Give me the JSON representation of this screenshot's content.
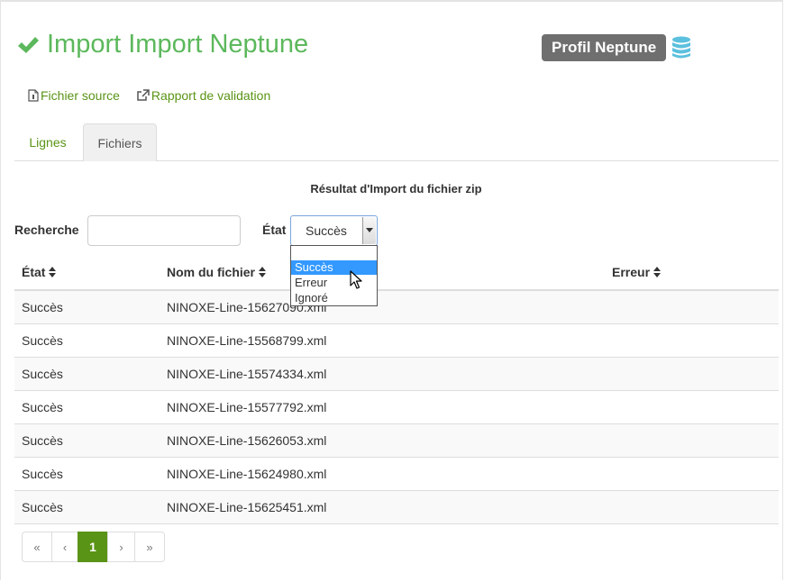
{
  "header": {
    "title": "Import Import Neptune",
    "profile_badge": "Profil Neptune"
  },
  "links": {
    "source_file": "Fichier source",
    "validation_report": "Rapport de validation"
  },
  "tabs": [
    {
      "label": "Lignes",
      "active": false
    },
    {
      "label": "Fichiers",
      "active": true
    }
  ],
  "section_title": "Résultat d'Import du fichier zip",
  "filters": {
    "search_label": "Recherche",
    "search_value": "",
    "state_label": "État",
    "state_selected": "Succès",
    "state_options": [
      "",
      "Succès",
      "Erreur",
      "Ignoré"
    ],
    "state_highlighted": "Succès"
  },
  "table": {
    "columns": [
      "État",
      "Nom du fichier",
      "Erreur"
    ],
    "rows": [
      {
        "etat": "Succès",
        "nom": "NINOXE-Line-15627090.xml",
        "erreur": ""
      },
      {
        "etat": "Succès",
        "nom": "NINOXE-Line-15568799.xml",
        "erreur": ""
      },
      {
        "etat": "Succès",
        "nom": "NINOXE-Line-15574334.xml",
        "erreur": ""
      },
      {
        "etat": "Succès",
        "nom": "NINOXE-Line-15577792.xml",
        "erreur": ""
      },
      {
        "etat": "Succès",
        "nom": "NINOXE-Line-15626053.xml",
        "erreur": ""
      },
      {
        "etat": "Succès",
        "nom": "NINOXE-Line-15624980.xml",
        "erreur": ""
      },
      {
        "etat": "Succès",
        "nom": "NINOXE-Line-15625451.xml",
        "erreur": ""
      }
    ]
  },
  "pagination": {
    "first": "«",
    "prev": "‹",
    "current": "1",
    "next": "›",
    "last": "»"
  },
  "colors": {
    "success_green": "#5cb85c",
    "link_green": "#5a9416",
    "badge_gray": "#6f6f6f",
    "db_icon_blue": "#5bc0de",
    "select_highlight": "#3399ff"
  }
}
